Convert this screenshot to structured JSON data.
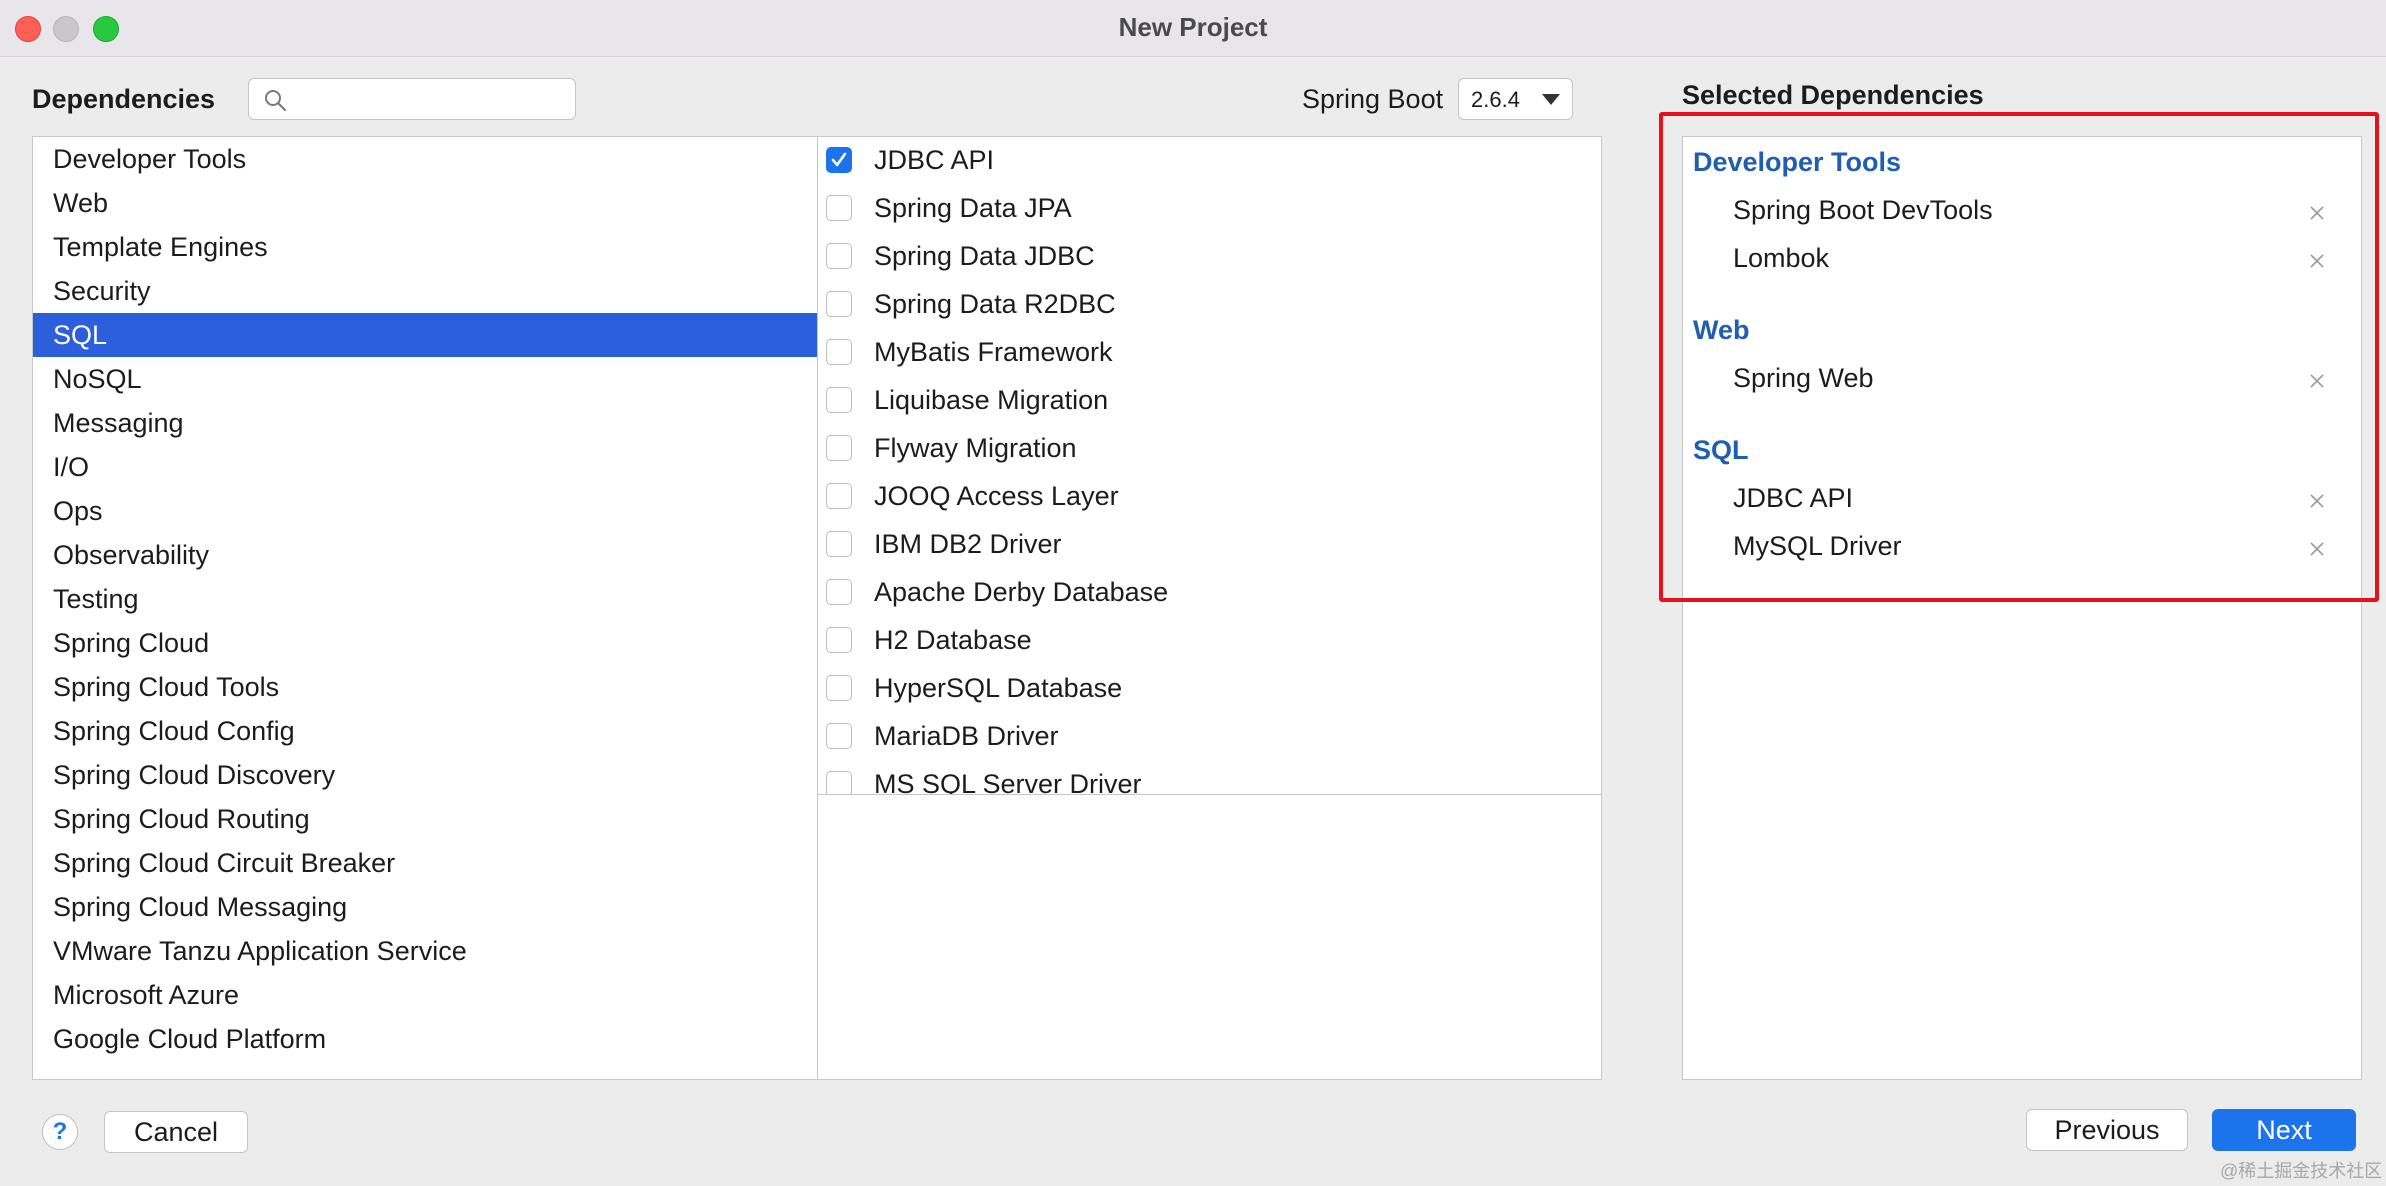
{
  "window": {
    "title": "New Project"
  },
  "header": {
    "dependencies_label": "Dependencies",
    "search_value": "",
    "spring_boot_label": "Spring Boot",
    "spring_boot_version": "2.6.4"
  },
  "categories": [
    "Developer Tools",
    "Web",
    "Template Engines",
    "Security",
    "SQL",
    "NoSQL",
    "Messaging",
    "I/O",
    "Ops",
    "Observability",
    "Testing",
    "Spring Cloud",
    "Spring Cloud Tools",
    "Spring Cloud Config",
    "Spring Cloud Discovery",
    "Spring Cloud Routing",
    "Spring Cloud Circuit Breaker",
    "Spring Cloud Messaging",
    "VMware Tanzu Application Service",
    "Microsoft Azure",
    "Google Cloud Platform"
  ],
  "selected_category": "SQL",
  "dependencies": [
    {
      "name": "JDBC API",
      "checked": true
    },
    {
      "name": "Spring Data JPA",
      "checked": false
    },
    {
      "name": "Spring Data JDBC",
      "checked": false
    },
    {
      "name": "Spring Data R2DBC",
      "checked": false
    },
    {
      "name": "MyBatis Framework",
      "checked": false
    },
    {
      "name": "Liquibase Migration",
      "checked": false
    },
    {
      "name": "Flyway Migration",
      "checked": false
    },
    {
      "name": "JOOQ Access Layer",
      "checked": false
    },
    {
      "name": "IBM DB2 Driver",
      "checked": false
    },
    {
      "name": "Apache Derby Database",
      "checked": false
    },
    {
      "name": "H2 Database",
      "checked": false
    },
    {
      "name": "HyperSQL Database",
      "checked": false
    },
    {
      "name": "MariaDB Driver",
      "checked": false
    },
    {
      "name": "MS SQL Server Driver",
      "checked": false
    }
  ],
  "selected": {
    "title": "Selected Dependencies",
    "groups": [
      {
        "name": "Developer Tools",
        "items": [
          "Spring Boot DevTools",
          "Lombok"
        ]
      },
      {
        "name": "Web",
        "items": [
          "Spring Web"
        ]
      },
      {
        "name": "SQL",
        "items": [
          "JDBC API",
          "MySQL Driver"
        ]
      }
    ]
  },
  "footer": {
    "help_label": "?",
    "cancel_label": "Cancel",
    "previous_label": "Previous",
    "next_label": "Next",
    "watermark": "@稀土掘金技术社区"
  },
  "colors": {
    "accent": "#1c74ec",
    "selection": "#2c5fdc",
    "group_title": "#1f5eb0",
    "highlight": "#e5121d"
  }
}
